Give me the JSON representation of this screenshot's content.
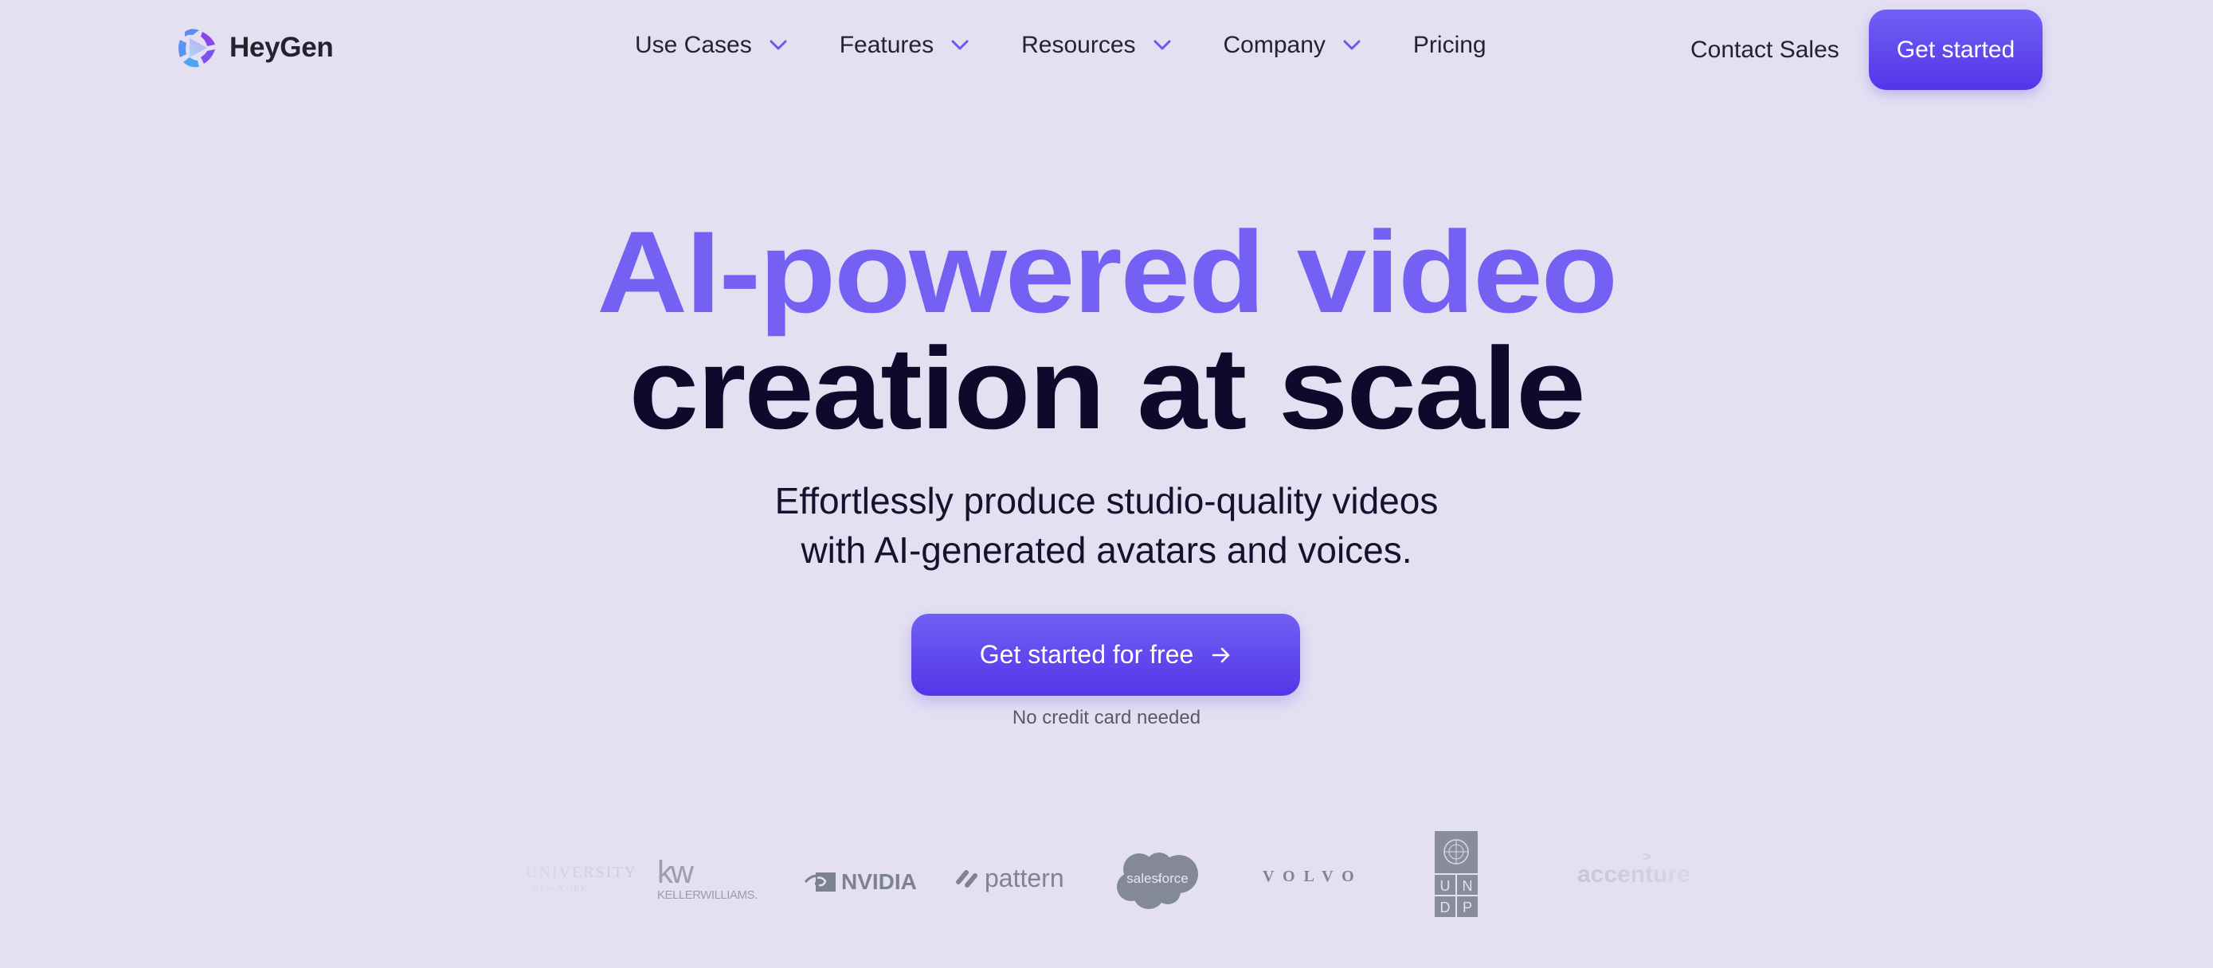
{
  "brand": {
    "name": "HeyGen",
    "logo_icon": "heygen-play-logo"
  },
  "nav": {
    "items": [
      {
        "label": "Use Cases",
        "has_dropdown": true
      },
      {
        "label": "Features",
        "has_dropdown": true
      },
      {
        "label": "Resources",
        "has_dropdown": true
      },
      {
        "label": "Company",
        "has_dropdown": true
      },
      {
        "label": "Pricing",
        "has_dropdown": false
      }
    ],
    "dropdown_icon": "chevron-down-icon",
    "contact_sales": "Contact Sales",
    "get_started": "Get started"
  },
  "hero": {
    "title_line1": "AI-powered video",
    "title_line2": "creation at scale",
    "subtitle_line1": "Effortlessly produce studio-quality videos",
    "subtitle_line2": "with AI-generated avatars and voices.",
    "cta_label": "Get started for free",
    "cta_icon": "arrow-right-icon",
    "cta_note": "No credit card needed"
  },
  "logos": {
    "items": [
      {
        "name": "University",
        "line1": "UNIVERSITY",
        "line2": "NEW YORK"
      },
      {
        "name": "Keller Williams",
        "mark": "kw",
        "text": "KELLERWILLIAMS."
      },
      {
        "name": "NVIDIA",
        "text": "NVIDIA"
      },
      {
        "name": "Pattern",
        "text": "pattern"
      },
      {
        "name": "Salesforce",
        "text": "salesforce"
      },
      {
        "name": "Volvo",
        "text": "VOLVO"
      },
      {
        "name": "UNDP",
        "letters": [
          "U",
          "N",
          "D",
          "P"
        ]
      },
      {
        "name": "Accenture",
        "text": "accenture",
        "mark": ">"
      }
    ]
  },
  "colors": {
    "background": "#e4e0f2",
    "accent": "#7460f3",
    "button_top": "#7160f4",
    "button_bottom": "#5335e8",
    "heading_dark": "#0e0a2b",
    "logo_gray": "#858a96"
  }
}
